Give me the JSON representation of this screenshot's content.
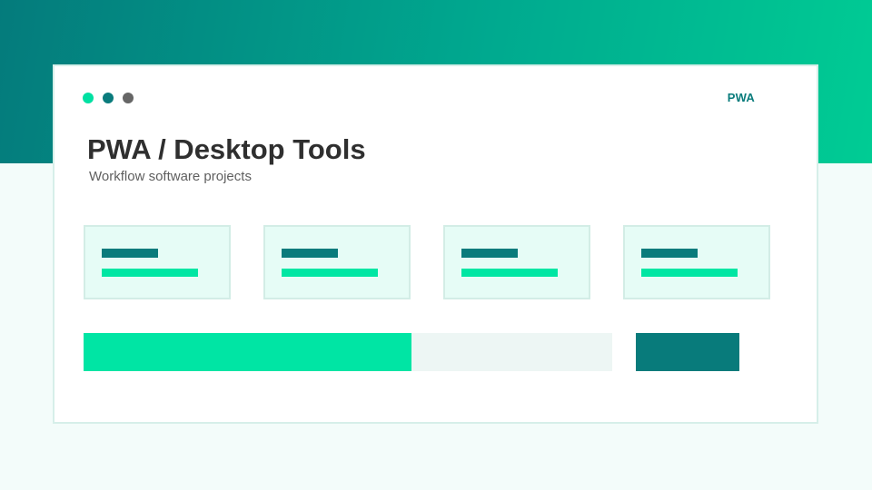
{
  "colors": {
    "hero_start": "#047b7c",
    "hero_end": "#00cc94",
    "page_background": "#f3fcfa",
    "accent_teal": "#0a7b7c",
    "accent_green": "#00e6a3",
    "dots": [
      "#00e0a2",
      "#0a7b7c",
      "#666666"
    ]
  },
  "window": {
    "controls": [
      "window-dot",
      "window-dot",
      "window-dot"
    ],
    "badge": "PWA"
  },
  "header": {
    "title": "PWA / Desktop Tools",
    "subtitle": "Workflow software projects"
  },
  "cards": [
    {
      "kind": "placeholder-card"
    },
    {
      "kind": "placeholder-card"
    },
    {
      "kind": "placeholder-card"
    },
    {
      "kind": "placeholder-card"
    }
  ],
  "progress": {
    "fraction": 0.62
  }
}
